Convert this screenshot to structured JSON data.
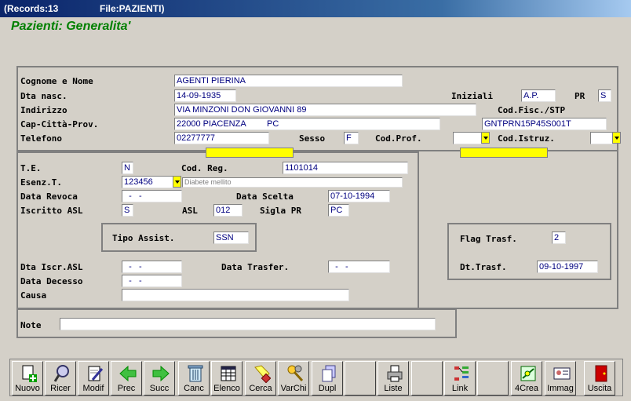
{
  "window": {
    "records": "(Records:13",
    "file": "File:PAZIENTI)"
  },
  "heading": "Pazienti: Generalita'",
  "labels": {
    "cognome": "Cognome e Nome",
    "dta_nasc": "Dta nasc.",
    "indirizzo": "Indirizzo",
    "cap": "Cap-Città-Prov.",
    "telefono": "Telefono",
    "iniziali": "Iniziali",
    "pr": "PR",
    "codfisc": "Cod.Fisc./STP",
    "sesso": "Sesso",
    "codprof": "Cod.Prof.",
    "codistruz": "Cod.Istruz.",
    "te": "T.E.",
    "codreg": "Cod. Reg.",
    "esenz": "Esenz.T.",
    "datarevoca": "Data Revoca",
    "datascelta": "Data Scelta",
    "iscritto": "Iscritto ASL",
    "asl": "ASL",
    "siglapr": "Sigla PR",
    "tipoassist": "Tipo Assist.",
    "dtaiscr": "Dta Iscr.ASL",
    "datatrasfer": "Data Trasfer.",
    "datadecesso": "Data Decesso",
    "causa": "Causa",
    "note": "Note",
    "flagtrasf": "Flag Trasf.",
    "dttrasf": "Dt.Trasf."
  },
  "values": {
    "cognome": "AGENTI PIERINA",
    "dta_nasc": "14-09-1935",
    "indirizzo": "VIA MINZONI DON GIOVANNI 89",
    "cap": "22000 PIACENZA",
    "prov": "PC",
    "telefono": "02277777",
    "iniziali": "A.P.",
    "pr": "S",
    "codfisc": "GNTPRN15P45S001T",
    "sesso": "F",
    "codprof": "",
    "codistruz": "",
    "te": "N",
    "codreg": "1101014",
    "esenz": "123456",
    "esenz_desc": "Diabete mellito",
    "datarevoca": "  -   -",
    "datascelta": "07-10-1994",
    "iscritto": "S",
    "asl": "012",
    "siglapr": "PC",
    "tipoassist": "SSN",
    "dtaiscr": "  -   -",
    "datatrasfer": "  -   -",
    "datadecesso": "  -   -",
    "causa": "",
    "note": "",
    "flagtrasf": "2",
    "dttrasf": "09-10-1997"
  },
  "toolbar": {
    "nuovo": "Nuovo",
    "ricer": "Ricer",
    "modif": "Modif",
    "prec": "Prec",
    "succ": "Succ",
    "canc": "Canc",
    "elenco": "Elenco",
    "cerca": "Cerca",
    "varchi": "VarChi",
    "dupl": "Dupl",
    "liste": "Liste",
    "link": "Link",
    "crea4": "4Crea",
    "immag": "Immag",
    "uscita": "Uscita"
  }
}
